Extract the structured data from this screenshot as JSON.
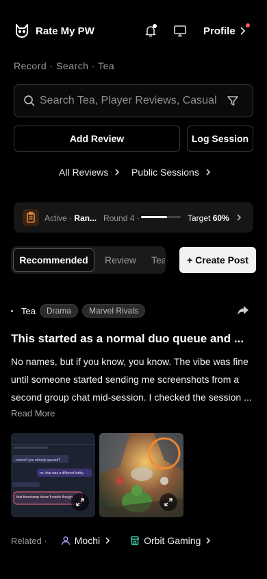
{
  "app": {
    "title": "Rate My PW"
  },
  "header": {
    "profile_label": "Profile"
  },
  "breadcrumb": "Record · Search · Tea",
  "search": {
    "placeholder": "Search Tea, Player Reviews, Casual"
  },
  "actions": {
    "add_review": "Add Review",
    "log_session": "Log Session"
  },
  "links": {
    "all_reviews": "All Reviews",
    "public_sessions": "Public Sessions"
  },
  "session": {
    "status": "Active ·",
    "name": "Ran...",
    "round": "Round 4 ·",
    "progress": 0.65,
    "target_label": "Target",
    "target_value": "60%"
  },
  "tabs": {
    "recommended": "Recommended",
    "review": "Review",
    "tea": "Tea"
  },
  "create_post": "+ Create Post",
  "post": {
    "category": "Tea",
    "tags": [
      "Drama",
      "Marvel Rivals"
    ],
    "title": "This started as a normal duo queue and ...",
    "body_lines": [
      "No names, but if you know, you know. The vibe was fine",
      "until someone started sending me screenshots from a",
      "second group chat mid-session. I checked the session ..."
    ],
    "read_more": "Read More",
    "chat_snippets": {
      "line1": "...weren't you already queued?",
      "line2": "no, that was a different lobby",
      "line3": "that timestamp doesn't match though"
    }
  },
  "related": {
    "label": "Related ·",
    "user": "Mochi",
    "org": "Orbit Gaming"
  },
  "colors": {
    "accent_orange": "#e08a3c",
    "notification_red": "#ff5a5f",
    "mochi_purple": "#b59cff",
    "orbit_teal": "#3fcfa8"
  }
}
